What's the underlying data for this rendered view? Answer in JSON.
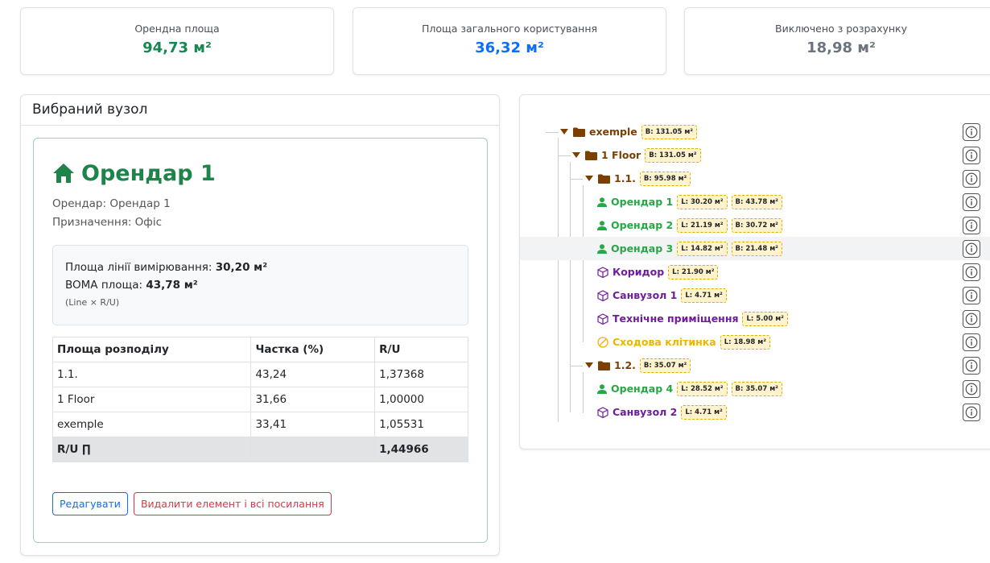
{
  "stats": [
    {
      "label": "Орендна площа",
      "value": "94,73 м²",
      "color": "#198754"
    },
    {
      "label": "Площа загального користування",
      "value": "36,32 м²",
      "color": "#0d6efd"
    },
    {
      "label": "Виключено з розрахунку",
      "value": "18,98 м²",
      "color": "#6c757d"
    }
  ],
  "selected": {
    "header": "Вибраний вузол",
    "title": "Орендар 1",
    "tenant_line": "Орендар: Орендар 1",
    "purpose_line": "Призначення: Офіс",
    "line_label": "Площа лінії вимірювання: ",
    "line_value": "30,20 м²",
    "boma_label": "BOMA площа: ",
    "boma_value": "43,78 м²",
    "formula": "(Line × R/U)",
    "table": {
      "headers": [
        "Площа розподілу",
        "Частка (%)",
        "R/U"
      ],
      "rows": [
        [
          "1.1.",
          "43,24",
          "1,37368"
        ],
        [
          "1 Floor",
          "31,66",
          "1,00000"
        ],
        [
          "exemple",
          "33,41",
          "1,05531"
        ]
      ],
      "total": [
        "R/U ∏",
        "",
        "1,44966"
      ]
    },
    "edit_label": "Редагувати",
    "delete_label": "Видалити елемент і всі посилання"
  },
  "tree": [
    {
      "label": "exemple",
      "type": "folder",
      "level": 0,
      "badges": [
        "B: 131.05 м²"
      ]
    },
    {
      "label": "1 Floor",
      "type": "folder",
      "level": 1,
      "badges": [
        "B: 131.05 м²"
      ]
    },
    {
      "label": "1.1.",
      "type": "folder",
      "level": 2,
      "badges": [
        "B: 95.98 м²"
      ]
    },
    {
      "label": "Орендар 1",
      "type": "tenant",
      "level": 3,
      "badges": [
        "L: 30.20 м²",
        "B: 43.78 м²"
      ]
    },
    {
      "label": "Орендар 2",
      "type": "tenant",
      "level": 3,
      "badges": [
        "L: 21.19 м²",
        "B: 30.72 м²"
      ]
    },
    {
      "label": "Орендар 3",
      "type": "tenant",
      "level": 3,
      "badges": [
        "L: 14.82 м²",
        "B: 21.48 м²"
      ]
    },
    {
      "label": "Коридор",
      "type": "common",
      "level": 3,
      "badges": [
        "L: 21.90 м²"
      ]
    },
    {
      "label": "Санвузол 1",
      "type": "common",
      "level": 3,
      "badges": [
        "L: 4.71 м²"
      ]
    },
    {
      "label": "Технічне приміщення",
      "type": "common",
      "level": 3,
      "badges": [
        "L: 5.00 м²"
      ]
    },
    {
      "label": "Сходова клітинка",
      "type": "excluded",
      "level": 3,
      "badges": [
        "L: 18.98 м²"
      ]
    },
    {
      "label": "1.2.",
      "type": "folder",
      "level": 2,
      "badges": [
        "B: 35.07 м²"
      ]
    },
    {
      "label": "Орендар 4",
      "type": "tenant",
      "level": 3,
      "badges": [
        "L: 28.52 м²",
        "B: 35.07 м²"
      ]
    },
    {
      "label": "Санвузол 2",
      "type": "common",
      "level": 3,
      "badges": [
        "L: 4.71 м²"
      ]
    }
  ],
  "colors": {
    "folder": "#7b3f00",
    "tenant": "#28a745",
    "common": "#6f1d9b",
    "excluded": "#f0b400"
  }
}
